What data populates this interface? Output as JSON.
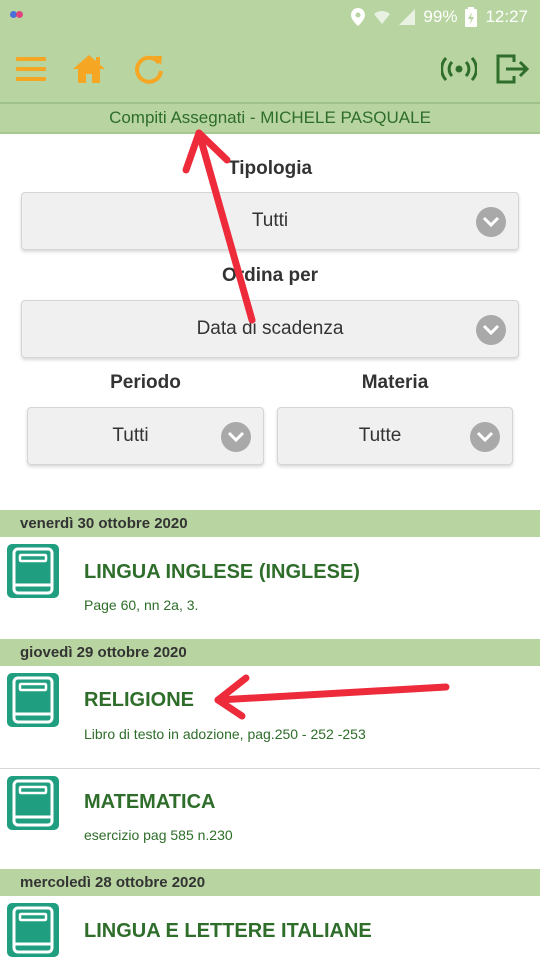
{
  "status_bar": {
    "battery": "99%",
    "time": "12:27",
    "icons": [
      "location-icon",
      "wifi-icon",
      "signal-icon",
      "battery-charging-icon"
    ]
  },
  "app_bar": {
    "icons": [
      "menu-icon",
      "home-icon",
      "refresh-icon",
      "broadcast-icon",
      "logout-icon"
    ],
    "accent_color": "#f5a623",
    "brand_color": "#2e6d2a"
  },
  "page_title": "Compiti Assegnati - MICHELE PASQUALE",
  "filters": {
    "tipologia_label": "Tipologia",
    "tipologia_value": "Tutti",
    "ordina_label": "Ordina per",
    "ordina_value": "Data di scadenza",
    "periodo_label": "Periodo",
    "periodo_value": "Tutti",
    "materia_label": "Materia",
    "materia_value": "Tutte"
  },
  "groups": [
    {
      "date": "venerdì 30 ottobre 2020",
      "items": [
        {
          "subject": "LINGUA INGLESE (INGLESE)",
          "description": "Page 60, nn 2a, 3."
        }
      ]
    },
    {
      "date": "giovedì 29 ottobre 2020",
      "items": [
        {
          "subject": "RELIGIONE",
          "description": "Libro di testo in adozione, pag.250 - 252 -253"
        },
        {
          "subject": "MATEMATICA",
          "description": "esercizio pag 585 n.230"
        }
      ]
    },
    {
      "date": "mercoledì 28 ottobre 2020",
      "items": [
        {
          "subject": "LINGUA E LETTERE ITALIANE",
          "description": ""
        }
      ]
    }
  ],
  "colors": {
    "header_bg": "#b7d4a1",
    "book_icon": "#1f9f7f",
    "annotation_arrow": "#ee2b3b"
  }
}
